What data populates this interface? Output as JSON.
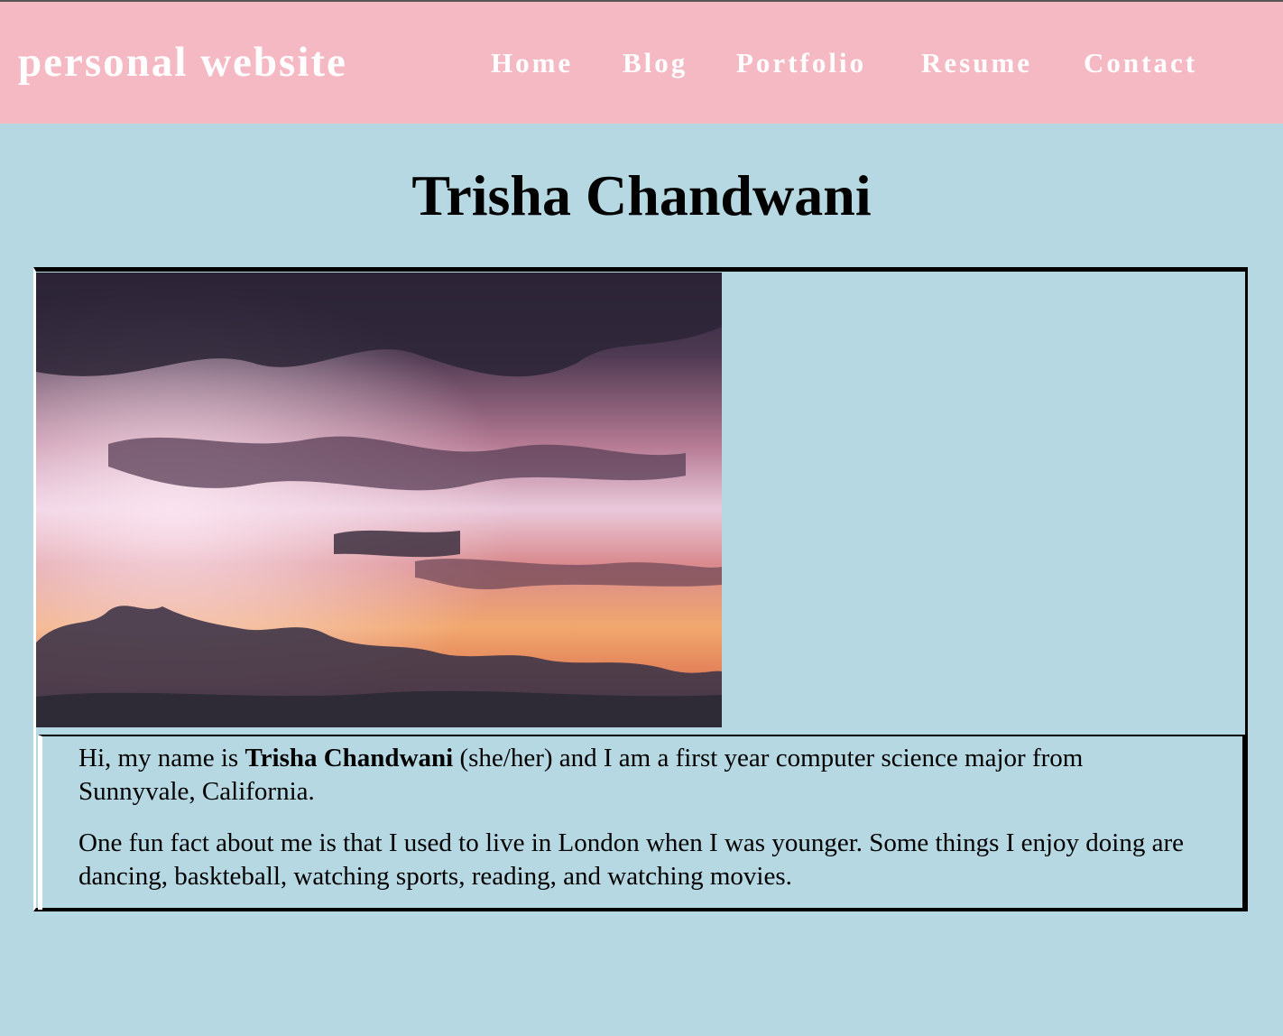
{
  "header": {
    "site_title": "personal website",
    "nav": [
      {
        "label": "Home"
      },
      {
        "label": "Blog"
      },
      {
        "label": "Portfolio"
      },
      {
        "label": "Resume"
      },
      {
        "label": "Contact"
      }
    ]
  },
  "main": {
    "heading": "Trisha Chandwani",
    "intro": {
      "before": "Hi, my name is ",
      "name": "Trisha Chandwani",
      "after": " (she/her) and I am a first year computer science major from Sunnyvale, California."
    },
    "fun_fact": "One fun fact about me is that I used to live in London when I was younger. Some things I enjoy doing are dancing, baskteball, watching sports, reading, and watching movies."
  },
  "colors": {
    "navbar": "#f5b9c4",
    "background": "#b5d8e3",
    "nav_text": "#ffffff"
  }
}
